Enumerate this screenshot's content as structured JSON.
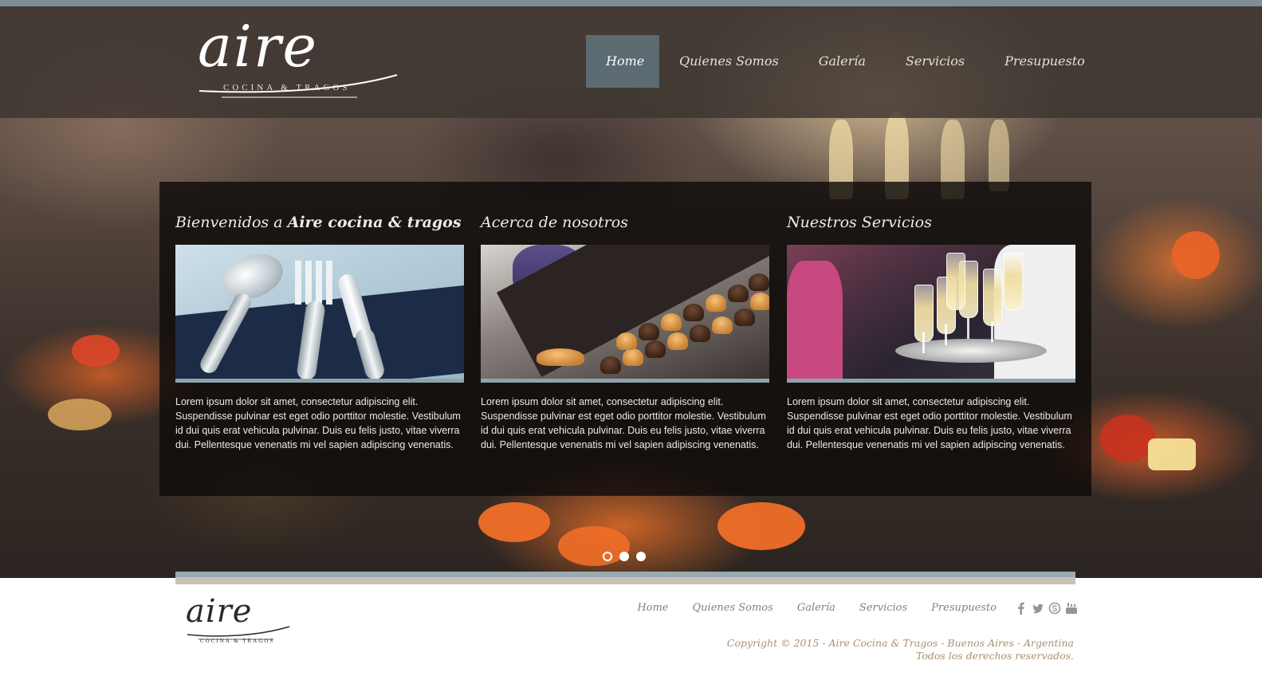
{
  "brand": {
    "logo_text": "aire",
    "tagline": "COCINA & TRAGOS"
  },
  "nav": {
    "items": [
      {
        "label": "Home",
        "active": true
      },
      {
        "label": "Quienes Somos",
        "active": false
      },
      {
        "label": "Galería",
        "active": false
      },
      {
        "label": "Servicios",
        "active": false
      },
      {
        "label": "Presupuesto",
        "active": false
      }
    ]
  },
  "columns": [
    {
      "title_prefix": "Bienvenidos a ",
      "title_bold": "Aire cocina & tragos",
      "image": "cutlery-photo",
      "text": "Lorem ipsum dolor sit amet, consectetur adipiscing elit. Suspendisse pulvinar est eget odio porttitor molestie. Vestibulum id dui quis erat vehicula pulvinar. Duis eu felis justo, vitae viverra dui. Pellentesque venenatis mi vel sapien adipiscing venenatis."
    },
    {
      "title_prefix": "Acerca de nosotros",
      "title_bold": "",
      "image": "pastries-photo",
      "text": "Lorem ipsum dolor sit amet, consectetur adipiscing elit. Suspendisse pulvinar est eget odio porttitor molestie. Vestibulum id dui quis erat vehicula pulvinar. Duis eu felis justo, vitae viverra dui. Pellentesque venenatis mi vel sapien adipiscing venenatis."
    },
    {
      "title_prefix": "Nuestros Servicios",
      "title_bold": "",
      "image": "champagne-photo",
      "text": "Lorem ipsum dolor sit amet, consectetur adipiscing elit. Suspendisse pulvinar est eget odio porttitor molestie. Vestibulum id dui quis erat vehicula pulvinar. Duis eu felis justo, vitae viverra dui. Pellentesque venenatis mi vel sapien adipiscing venenatis."
    }
  ],
  "slider": {
    "slides": 3,
    "active_index": 0
  },
  "footer": {
    "logo_text": "aire",
    "tagline": "COCINA & TRAGOS",
    "nav": [
      "Home",
      "Quienes Somos",
      "Galería",
      "Servicios",
      "Presupuesto"
    ],
    "social": [
      "facebook-icon",
      "twitter-icon",
      "skype-icon",
      "youtube-icon"
    ],
    "copyright_line1": "Copyright © 2015 - Aire Cocina & Tragos - Buenos Aires - Argentina",
    "copyright_line2": "Todos los derechos reservados."
  },
  "colors": {
    "nav_active_bg": "#5b6b71",
    "accent_bar": "#9aaab1",
    "accent_bar_secondary": "#c9c2b5",
    "footer_link": "#8a8176",
    "copyright": "#a8906f"
  }
}
